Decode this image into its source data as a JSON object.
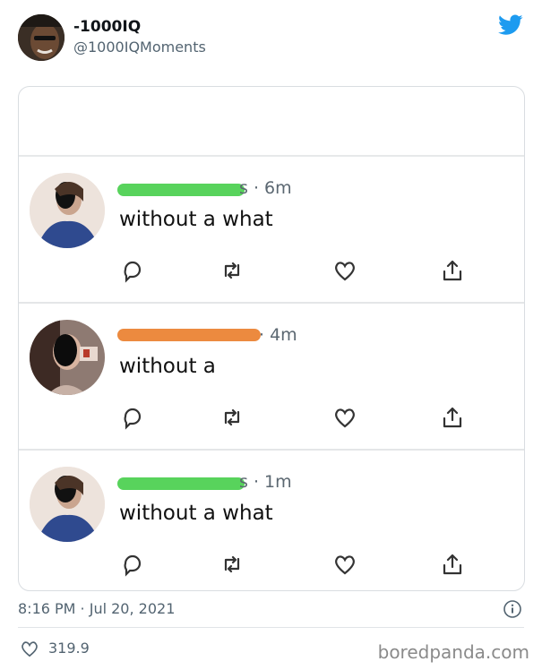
{
  "author": {
    "display_name": "-1000IQ",
    "handle": "@1000IQMoments"
  },
  "embedded_tweets": [
    {
      "name_tail": "s · 6m",
      "name_redaction_color": "#58d35c",
      "text": "without a what"
    },
    {
      "name_tail": "· 4m",
      "name_redaction_color": "#ec8a3f",
      "text": "without a"
    },
    {
      "name_tail": "s · 1m",
      "name_redaction_color": "#58d35c",
      "text": "without a what"
    }
  ],
  "footer": {
    "timestamp": "8:16 PM · Jul 20, 2021",
    "like_count": "319.9"
  },
  "watermark": "boredpanda.com",
  "colors": {
    "twitter_blue": "#1d9bf0",
    "green_redaction": "#58d35c",
    "orange_redaction": "#ec8a3f"
  }
}
